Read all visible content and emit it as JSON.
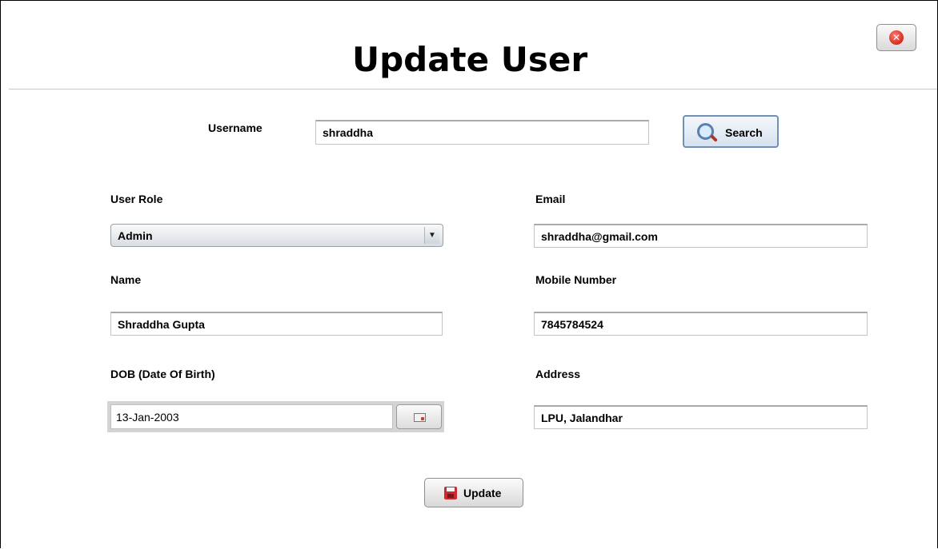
{
  "window": {
    "title": "Update User"
  },
  "search": {
    "label": "Username",
    "value": "shraddha",
    "button_label": "Search"
  },
  "form": {
    "user_role": {
      "label": "User Role",
      "value": "Admin"
    },
    "email": {
      "label": "Email",
      "value": "shraddha@gmail.com"
    },
    "name": {
      "label": "Name",
      "value": "Shraddha Gupta"
    },
    "mobile": {
      "label": "Mobile Number",
      "value": "7845784524"
    },
    "dob": {
      "label": "DOB (Date Of Birth)",
      "value": "13-Jan-2003"
    },
    "address": {
      "label": "Address",
      "value": "LPU, Jalandhar"
    }
  },
  "actions": {
    "update_label": "Update"
  },
  "icons": {
    "close": "close-icon",
    "search": "magnifier-icon",
    "calendar": "calendar-icon",
    "update": "save-disk-icon"
  },
  "colors": {
    "close_red": "#d62a1e",
    "search_border": "#6f90b8",
    "save_red": "#d0282c"
  }
}
